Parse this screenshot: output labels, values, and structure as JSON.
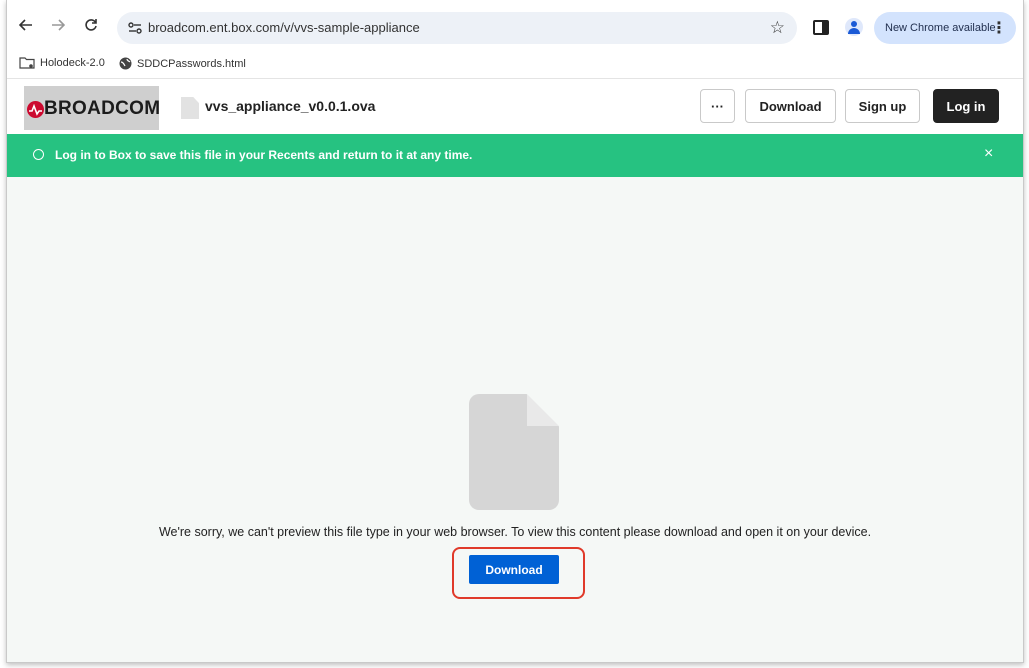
{
  "browser": {
    "url": "broadcom.ent.box.com/v/vvs-sample-appliance",
    "update_label": "New Chrome available",
    "bookmarks": [
      {
        "label": "Holodeck-2.0",
        "icon": "folder-icon"
      },
      {
        "label": "SDDCPasswords.html",
        "icon": "globe-icon"
      }
    ]
  },
  "header": {
    "logo_text": "BROADCOM",
    "file_name": "vvs_appliance_v0.0.1.ova",
    "more_label": "···",
    "download_label": "Download",
    "signup_label": "Sign up",
    "login_label": "Log in"
  },
  "banner": {
    "text": "Log in to Box to save this file in your Recents and return to it at any time.",
    "close_label": "×"
  },
  "preview": {
    "message": "We're sorry, we can't preview this file type in your web browser. To view this content please download and open it on your device.",
    "download_label": "Download"
  },
  "colors": {
    "banner": "#26c281",
    "primary_button": "#0061d5",
    "highlight": "#e03a2a",
    "brand_red": "#cc092f"
  }
}
